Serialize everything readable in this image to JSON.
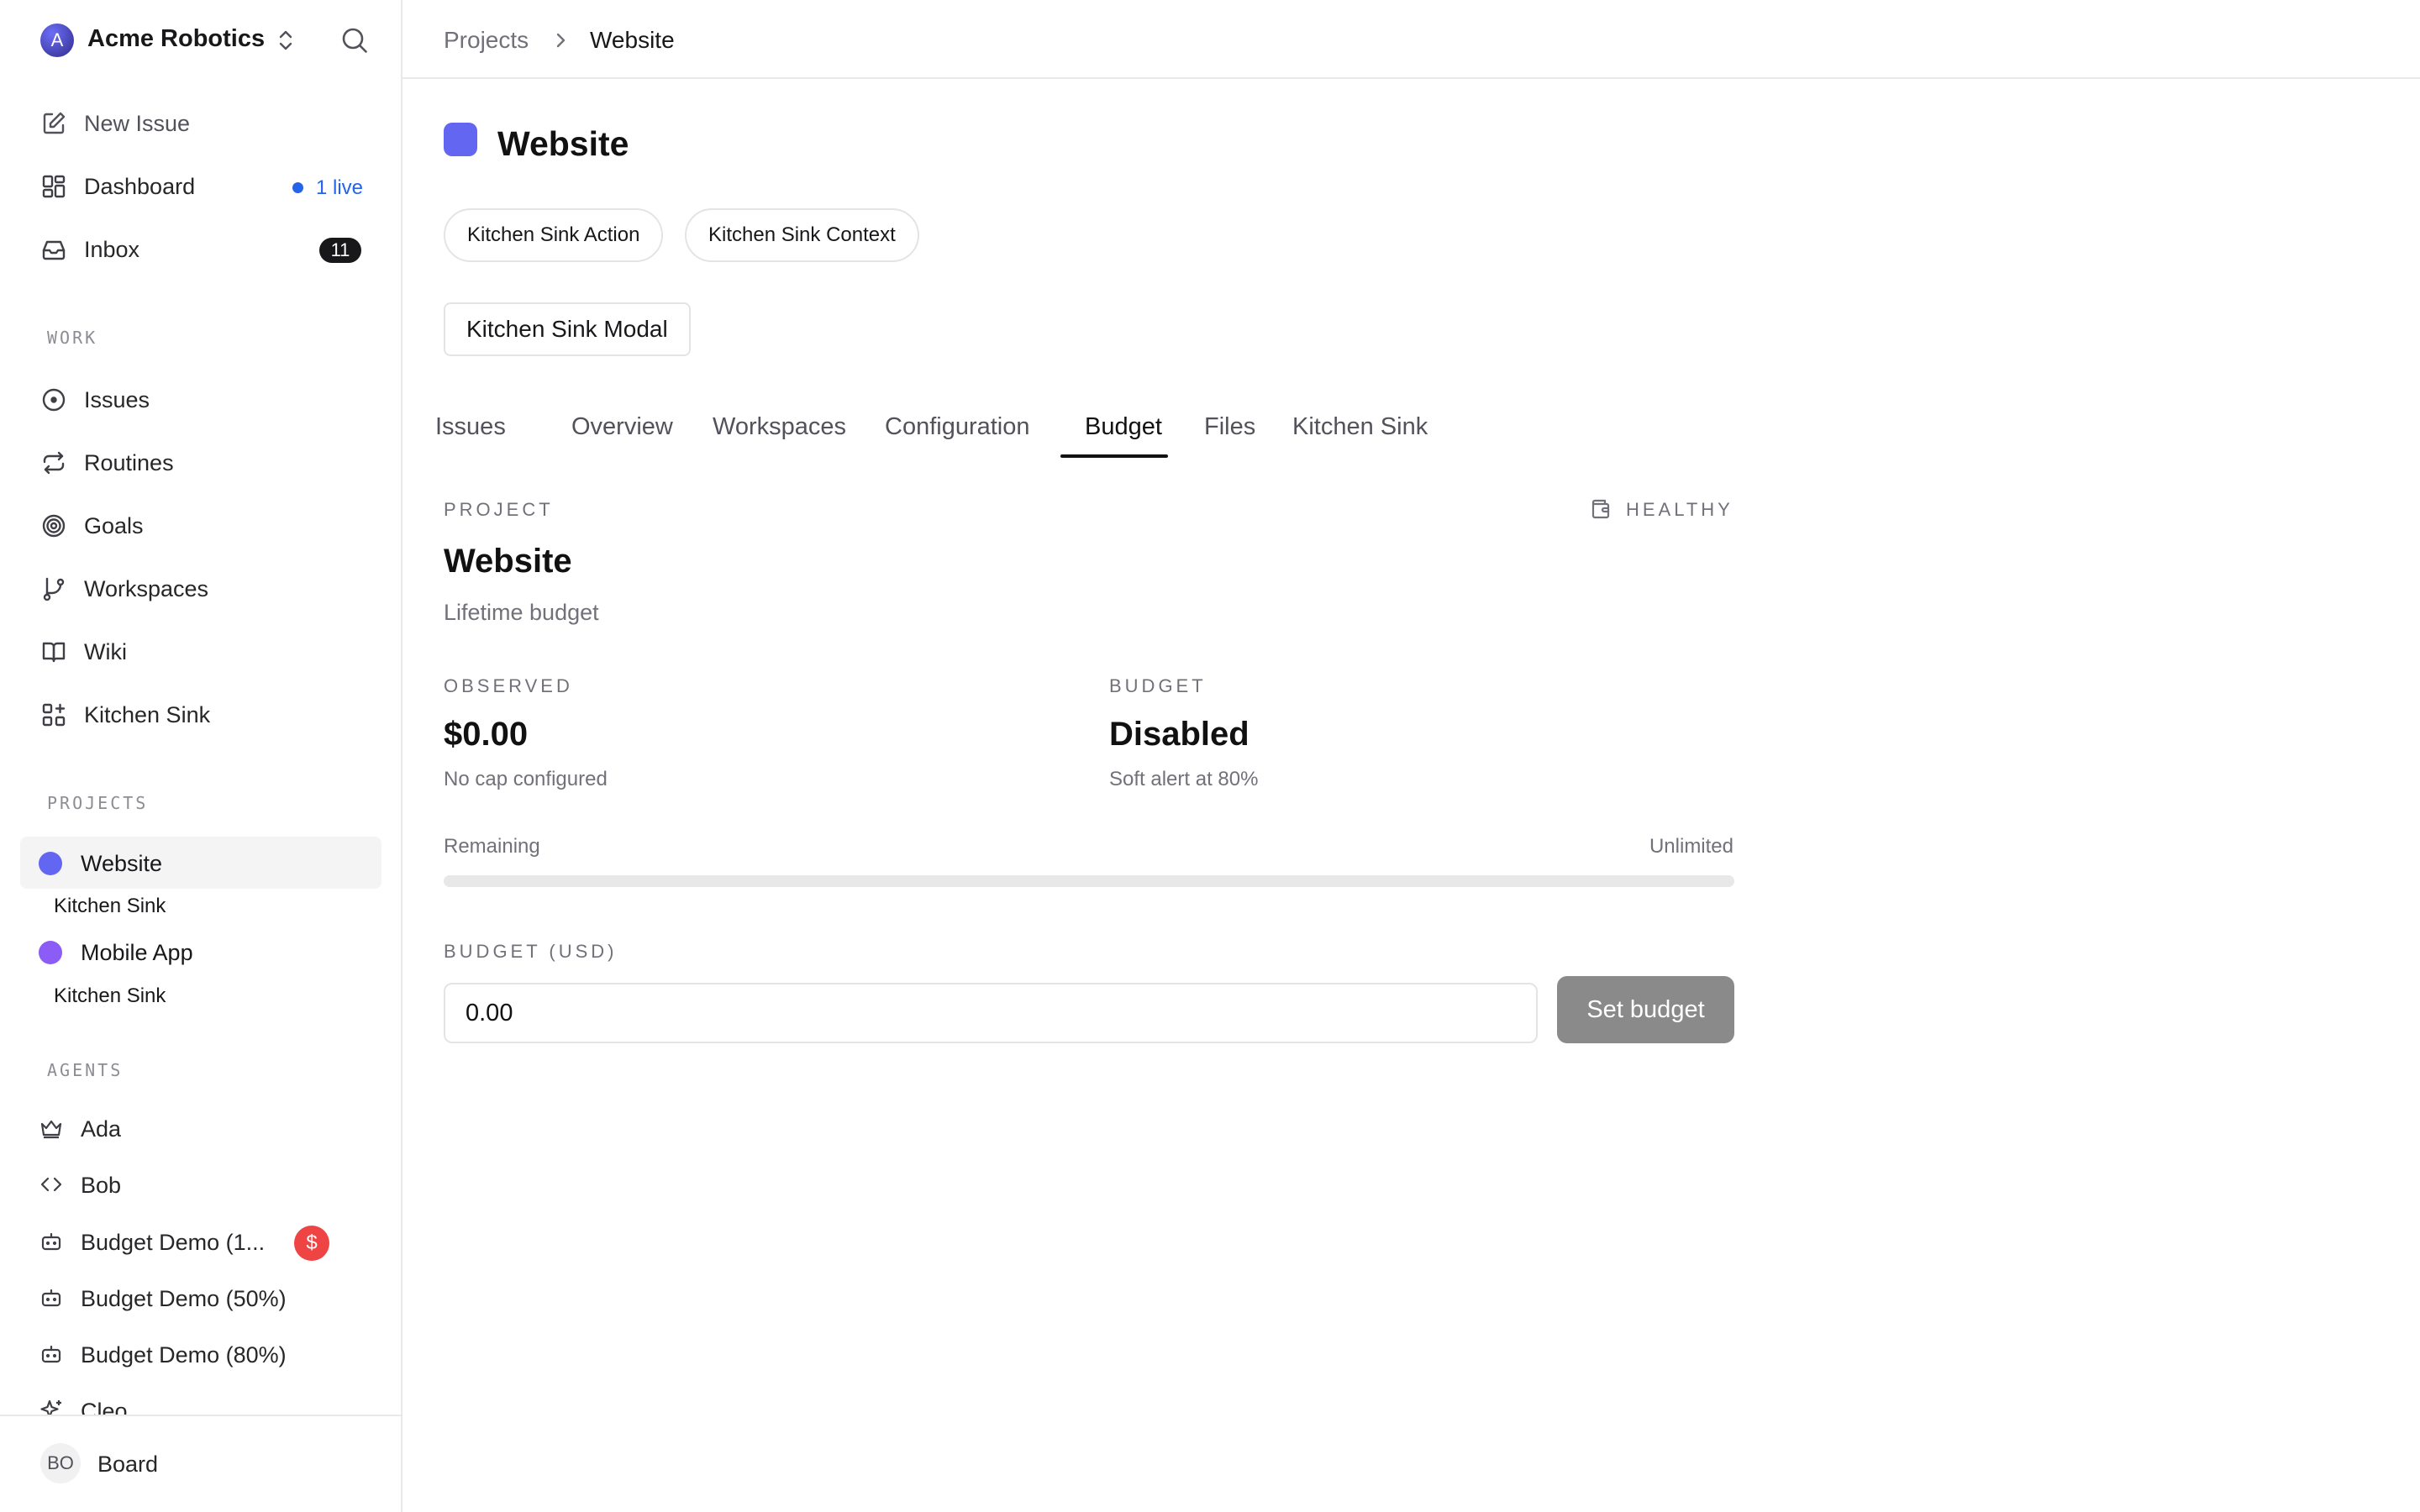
{
  "workspace": {
    "name": "Acme Robotics",
    "avatar_letter": "A"
  },
  "sidebar": {
    "new_issue": "New Issue",
    "dashboard": {
      "label": "Dashboard",
      "live": "1 live"
    },
    "inbox": {
      "label": "Inbox",
      "count": "11"
    },
    "work_label": "WORK",
    "work_items": [
      {
        "label": "Issues",
        "icon": "circle-dot-icon"
      },
      {
        "label": "Routines",
        "icon": "repeat-icon"
      },
      {
        "label": "Goals",
        "icon": "target-icon"
      },
      {
        "label": "Workspaces",
        "icon": "git-branch-icon"
      },
      {
        "label": "Wiki",
        "icon": "book-icon"
      },
      {
        "label": "Kitchen Sink",
        "icon": "grid-plus-icon"
      }
    ],
    "projects_label": "PROJECTS",
    "projects": [
      {
        "label": "Website",
        "color": "#6366f1",
        "sub": "Kitchen Sink"
      },
      {
        "label": "Mobile App",
        "color": "#8b5cf6",
        "sub": "Kitchen Sink"
      }
    ],
    "agents_label": "AGENTS",
    "agents": [
      {
        "label": "Ada",
        "icon": "crown-icon"
      },
      {
        "label": "Bob",
        "icon": "code-icon"
      },
      {
        "label": "Budget Demo (1...",
        "icon": "bot-icon",
        "alert": "$"
      },
      {
        "label": "Budget Demo (50%)",
        "icon": "bot-icon"
      },
      {
        "label": "Budget Demo (80%)",
        "icon": "bot-icon"
      },
      {
        "label": "Cleo",
        "icon": "sparkle-icon"
      }
    ],
    "user": {
      "initials": "BO",
      "name": "Board"
    }
  },
  "breadcrumb": {
    "parent": "Projects",
    "current": "Website"
  },
  "project": {
    "title": "Website",
    "color": "#6366f1",
    "actions": [
      "Kitchen Sink Action",
      "Kitchen Sink Context"
    ],
    "modal_button": "Kitchen Sink Modal"
  },
  "tabs": [
    "Issues",
    "Overview",
    "Workspaces",
    "Configuration",
    "Budget",
    "Files",
    "Kitchen Sink"
  ],
  "active_tab": "Budget",
  "budget": {
    "overline": "PROJECT",
    "status": "HEALTHY",
    "title": "Website",
    "subtitle": "Lifetime budget",
    "observed_label": "OBSERVED",
    "observed_value": "$0.00",
    "observed_note": "No cap configured",
    "budget_label": "BUDGET",
    "budget_value": "Disabled",
    "budget_note": "Soft alert at 80%",
    "remaining_label": "Remaining",
    "remaining_value": "Unlimited",
    "progress_fraction": 0,
    "input_label": "BUDGET (USD)",
    "input_value": "0.00",
    "set_button": "Set budget"
  }
}
